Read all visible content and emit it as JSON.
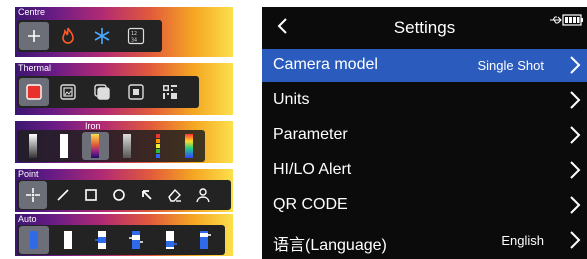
{
  "left_panels": {
    "centre": {
      "label": "Centre",
      "buttons": [
        "crosshair-icon",
        "flame-icon",
        "snowflake-icon",
        "grid-numbers-icon"
      ]
    },
    "thermal": {
      "label": "Thermal",
      "buttons": [
        "thermal-full-icon",
        "picture-in-picture-icon",
        "blend-icon",
        "center-box-icon",
        "qr-icon"
      ]
    },
    "palette": {
      "label": "Iron",
      "buttons": [
        "white-hot",
        "black-hot",
        "iron",
        "grey",
        "rainbow",
        "rainbow-hc"
      ]
    },
    "point": {
      "label": "Point",
      "buttons": [
        "point-icon",
        "line-icon",
        "rectangle-icon",
        "circle-icon",
        "arrow-icon",
        "eraser-icon",
        "person-icon"
      ]
    },
    "auto": {
      "label": "Auto",
      "buttons": [
        "level-1",
        "level-2",
        "level-3",
        "level-4",
        "level-5",
        "level-6"
      ]
    }
  },
  "settings": {
    "title": "Settings",
    "items": [
      {
        "label": "Camera model",
        "value": "Single Shot"
      },
      {
        "label": "Units",
        "value": ""
      },
      {
        "label": "Parameter",
        "value": ""
      },
      {
        "label": "HI/LO Alert",
        "value": ""
      },
      {
        "label": "QR CODE",
        "value": ""
      },
      {
        "label": "语言(Language)",
        "value": "English"
      }
    ]
  },
  "colors": {
    "accent": "#2a5bbd",
    "panel_bg": "#0b0b0b",
    "selected_btn": "#6c6f78"
  }
}
